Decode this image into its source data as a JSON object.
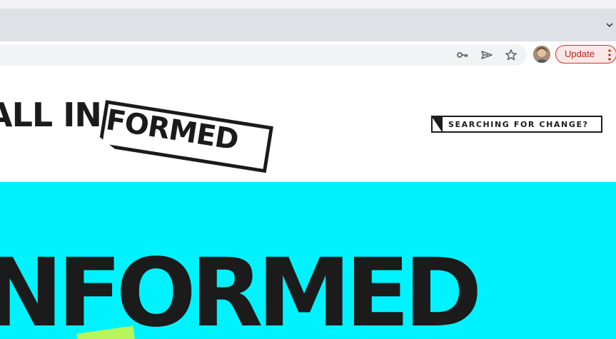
{
  "browser": {
    "update_label": "Update",
    "icons": {
      "tab_menu": "chevron-down-icon",
      "password": "key-icon",
      "send": "send-icon",
      "bookmark": "star-icon",
      "avatar": "profile-avatar",
      "menu": "more-vert-icon"
    },
    "colors": {
      "update_border": "#d93025",
      "tab_bar": "#dee1e6"
    }
  },
  "site": {
    "logo_left": "ALL IN",
    "logo_boxed": "FORMED",
    "search_tag": "SEARCHING FOR CHANGE?",
    "hero_word": "NFORMED",
    "colors": {
      "hero_bg": "#00f2ff",
      "ink": "#1b1b1b",
      "accent": "#b8f55a"
    }
  }
}
